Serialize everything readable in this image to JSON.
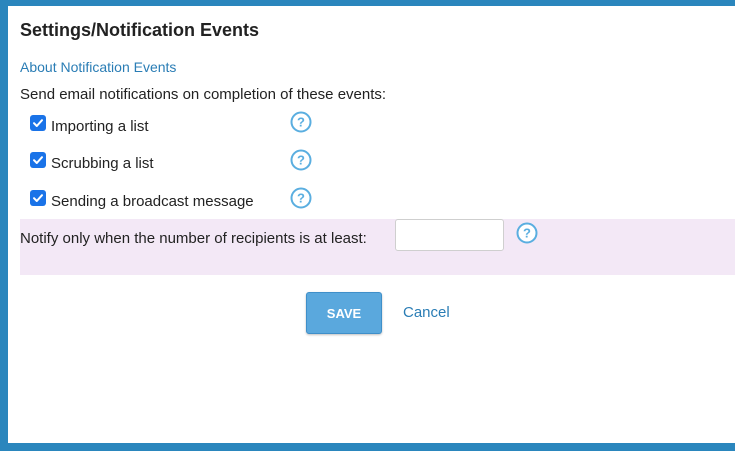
{
  "header": {
    "title": "Settings/Notification Events"
  },
  "about_link": "About Notification Events",
  "intro": "Send email notifications on completion of these events:",
  "events": [
    {
      "label": "Importing a list",
      "checked": true,
      "help_icon": "question-circle-icon"
    },
    {
      "label": "Scrubbing a list",
      "checked": true,
      "help_icon": "question-circle-icon"
    },
    {
      "label": "Sending a broadcast message",
      "checked": true,
      "help_icon": "question-circle-icon"
    }
  ],
  "threshold": {
    "label": "Notify only when the number of recipients is at least:",
    "value": "",
    "placeholder": "",
    "help_icon": "question-circle-icon"
  },
  "actions": {
    "save_label": "SAVE",
    "cancel_label": "Cancel"
  },
  "colors": {
    "frame": "#2a86bd",
    "link": "#2a7db5",
    "checkbox": "#1a73e8",
    "help_icon": "#5aaee0",
    "threshold_bg": "#f3e8f6",
    "save_button": "#5aa8dd"
  }
}
